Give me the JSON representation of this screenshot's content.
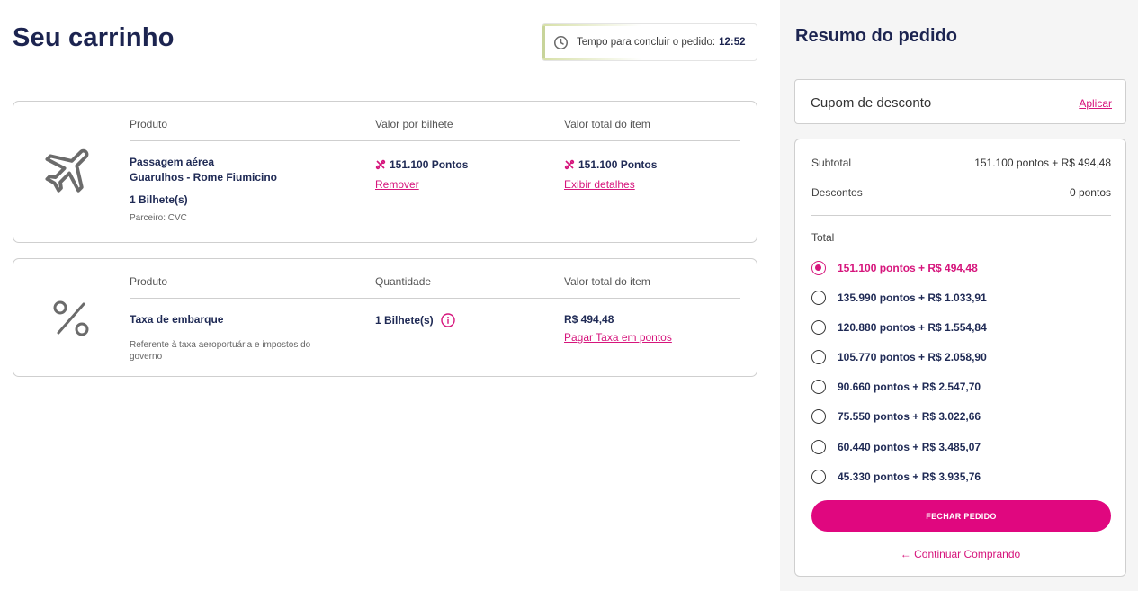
{
  "cart": {
    "title": "Seu carrinho",
    "timer": {
      "label": "Tempo para concluir o pedido:",
      "time": "12:52"
    },
    "items": [
      {
        "headers": [
          "Produto",
          "Valor por bilhete",
          "Valor total do item"
        ],
        "product_name": "Passagem aérea",
        "route": "Guarulhos - Rome Fiumicino",
        "quantity": "1 Bilhete(s)",
        "partner": "Parceiro: CVC",
        "unit_value": "151.100 Pontos",
        "total_value": "151.100 Pontos",
        "remove_link": "Remover",
        "details_link": "Exibir detalhes"
      },
      {
        "headers": [
          "Produto",
          "Quantidade",
          "Valor total do item"
        ],
        "product_name": "Taxa de embarque",
        "description": "Referente à taxa aeroportuária e impostos do governo",
        "quantity": "1 Bilhete(s)",
        "total_value": "R$ 494,48",
        "pay_points_link": "Pagar Taxa em pontos"
      }
    ]
  },
  "summary": {
    "title": "Resumo do pedido",
    "coupon": {
      "label": "Cupom de desconto",
      "apply": "Aplicar"
    },
    "subtotal_label": "Subtotal",
    "subtotal_value": "151.100 pontos + R$ 494,48",
    "discount_label": "Descontos",
    "discount_value": "0 pontos",
    "total_label": "Total",
    "options": [
      {
        "label": "151.100 pontos + R$ 494,48",
        "selected": true
      },
      {
        "label": "135.990 pontos + R$ 1.033,91",
        "selected": false
      },
      {
        "label": "120.880 pontos + R$ 1.554,84",
        "selected": false
      },
      {
        "label": "105.770 pontos + R$ 2.058,90",
        "selected": false
      },
      {
        "label": "90.660 pontos + R$ 2.547,70",
        "selected": false
      },
      {
        "label": "75.550 pontos + R$ 3.022,66",
        "selected": false
      },
      {
        "label": "60.440 pontos + R$ 3.485,07",
        "selected": false
      },
      {
        "label": "45.330 pontos + R$ 3.935,76",
        "selected": false
      }
    ],
    "checkout_button": "FECHAR PEDIDO",
    "continue_link": "← Continuar Comprando"
  },
  "colors": {
    "accent": "#e0077f",
    "title": "#1c2450",
    "border": "#cfcfcf"
  },
  "icons": {
    "flight": "airplane-icon",
    "tax": "percent-icon",
    "timer": "clock-icon",
    "points": "points-icon",
    "info": "info-icon"
  }
}
